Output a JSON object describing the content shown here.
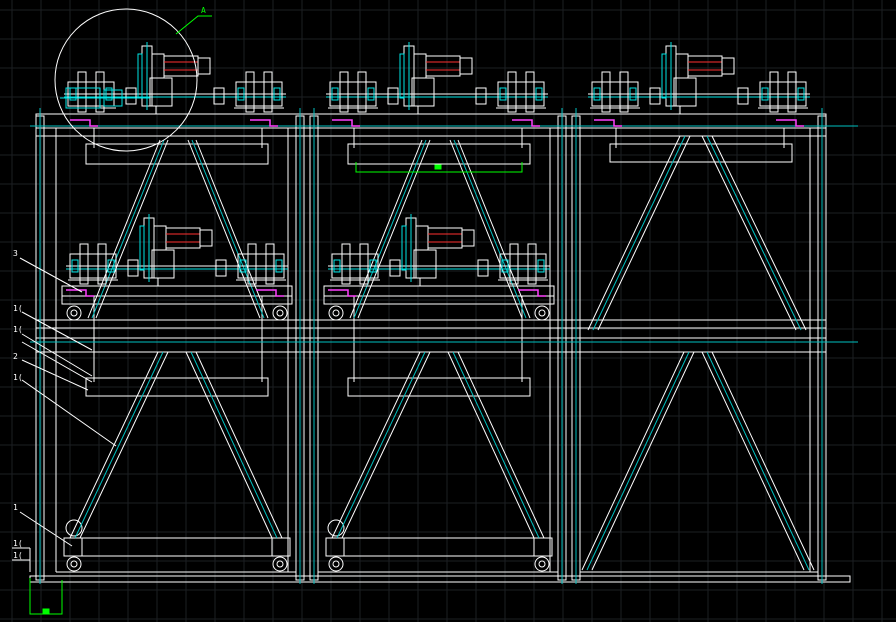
{
  "drawing": {
    "background": "#000000",
    "colors": {
      "grid": "#1c1f22",
      "outline": "#ffffff",
      "centerline": "#00c0c0",
      "cyan_part": "#00e5e5",
      "magenta_part": "#ff40ff",
      "red_part": "#ff3030",
      "green_dim": "#00ff00"
    },
    "detail_callout": "A",
    "part_labels": {
      "top_left": "1",
      "bottom_left_a": "1(",
      "bottom_left_b": "1(",
      "mid_1": "3",
      "mid_2": "1(",
      "mid_3": "1(",
      "mid_4": "2",
      "mid_5": "1("
    },
    "units": [
      {
        "id": "left",
        "upper_motor": true,
        "lower_motor": true
      },
      {
        "id": "middle",
        "upper_motor": true,
        "lower_motor": true
      },
      {
        "id": "right",
        "upper_motor": true,
        "lower_motor": false
      }
    ]
  }
}
